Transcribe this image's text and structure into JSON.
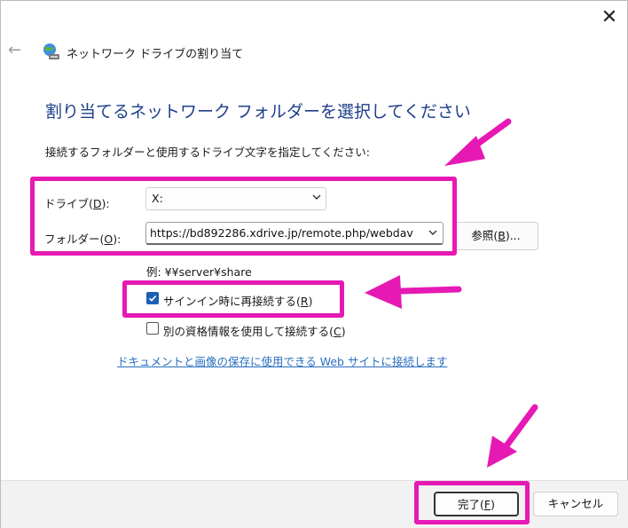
{
  "window": {
    "title": "ネットワーク ドライブの割り当て",
    "close_glyph": "✕",
    "back_glyph": "←"
  },
  "heading": "割り当てるネットワーク フォルダーを選択してください",
  "instruction": "接続するフォルダーと使用するドライブ文字を指定してください:",
  "drive": {
    "label_pre": "ドライブ(",
    "label_key": "D",
    "label_post": "):",
    "value": "X:"
  },
  "folder": {
    "label_pre": "フォルダー(",
    "label_key": "O",
    "label_post": "):",
    "value": "https://bd892286.xdrive.jp/remote.php/webdav"
  },
  "browse_button": {
    "label_pre": "参照(",
    "label_key": "B",
    "label_post": ")..."
  },
  "example": "例: ¥¥server¥share",
  "reconnect": {
    "label_pre": "サインイン時に再接続する(",
    "label_key": "R",
    "label_post": ")",
    "checked": true
  },
  "other_credentials": {
    "label_pre": "別の資格情報を使用して接続する(",
    "label_key": "C",
    "label_post": ")",
    "checked": false
  },
  "link": "ドキュメントと画像の保存に使用できる Web サイトに接続します",
  "footer": {
    "finish_pre": "完了(",
    "finish_key": "F",
    "finish_post": ")",
    "cancel": "キャンセル"
  },
  "colors": {
    "accent": "#1a5fb4",
    "heading": "#1e3f8a",
    "highlight": "#e619b4",
    "link": "#2a6fc0"
  },
  "icons": {
    "network_drive": "network-drive-icon",
    "chevron": "chevron-down-icon",
    "check": "checkmark-icon"
  }
}
